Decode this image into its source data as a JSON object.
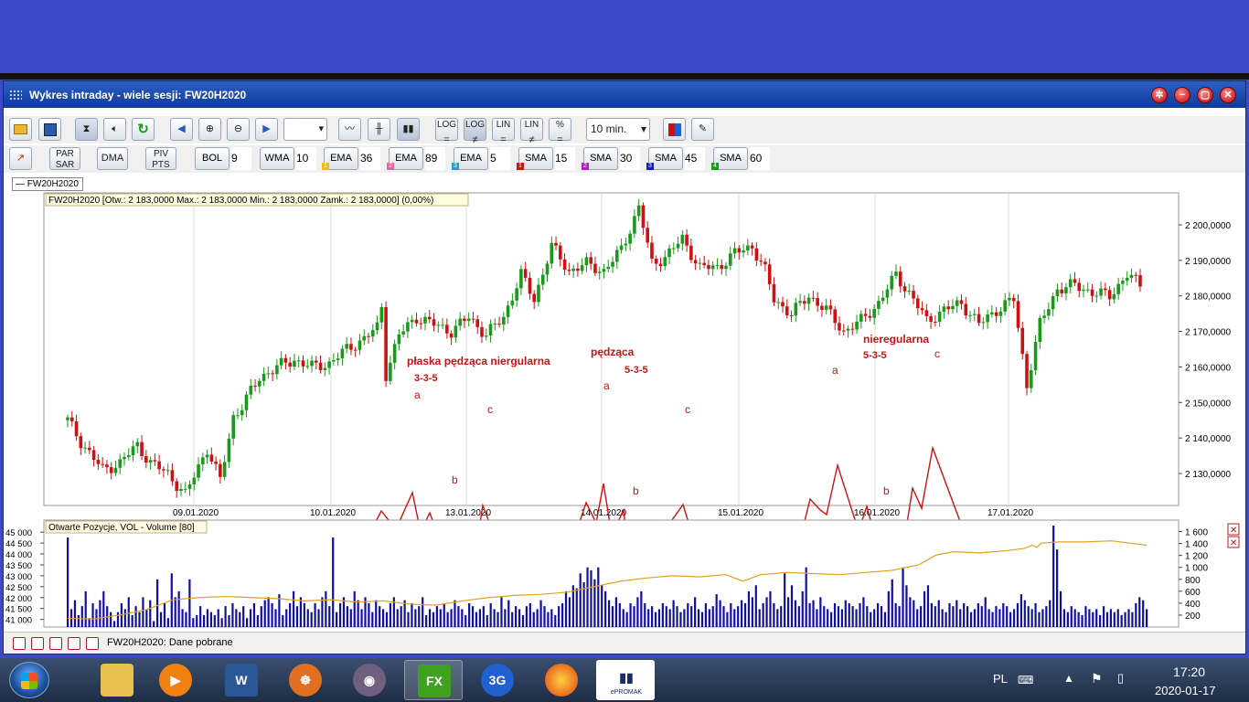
{
  "window": {
    "title": "Wykres intraday -  wiele sesji: FW20H2020"
  },
  "toolbar1": {
    "period_value": "",
    "interval_value": "10 min."
  },
  "toolbar1_labels": {
    "log1": "LOG",
    "log2": "LOG",
    "lin1": "LIN",
    "lin2": "LIN",
    "pct": "%"
  },
  "toolbar2": {
    "par_sar": [
      "PAR",
      "SAR"
    ],
    "dma": "DMA",
    "piv_pts": [
      "PIV",
      "PTS"
    ],
    "indicators": [
      {
        "label": "BOL",
        "value": "9"
      },
      {
        "label": "WMA",
        "value": "10"
      },
      {
        "label": "EMA",
        "value": "36",
        "marker": "1",
        "marker_color": "#f0c000"
      },
      {
        "label": "EMA",
        "value": "89",
        "marker": "2",
        "marker_color": "#f060a0"
      },
      {
        "label": "EMA",
        "value": "5",
        "marker": "3",
        "marker_color": "#20a0d0"
      },
      {
        "label": "SMA",
        "value": "15",
        "marker": "1",
        "marker_color": "#d01010"
      },
      {
        "label": "SMA",
        "value": "30",
        "marker": "2",
        "marker_color": "#b020c0"
      },
      {
        "label": "SMA",
        "value": "45",
        "marker": "3",
        "marker_color": "#1020c0"
      },
      {
        "label": "SMA",
        "value": "60",
        "marker": "4",
        "marker_color": "#10a010"
      }
    ]
  },
  "legend": {
    "symbol": "— FW20H2020"
  },
  "chart_data": [
    {
      "type": "candlestick",
      "info": "FW20H2020 [Otw.: 2 183,0000  Max.: 2 183,0000  Min.: 2 183,0000  Zamk.: 2 183,0000] (0,00%)",
      "yticks": [
        2200000,
        2190000,
        2180000,
        2170000,
        2160000,
        2150000,
        2140000,
        2130000
      ],
      "ytick_labels": [
        "2 200,0000",
        "2 190,0000",
        "2 180,0000",
        "2 170,0000",
        "2 160,0000",
        "2 150,0000",
        "2 140,0000",
        "2 130,0000"
      ],
      "ylim": [
        2121,
        2209
      ],
      "x_labels": [
        "09.01.2020",
        "10.01.2020",
        "13.01.2020",
        "14.01.2020",
        "15.01.2020",
        "16.01.2020",
        "17.01.2020"
      ],
      "price_path": [
        [
          0,
          2145
        ],
        [
          3,
          2139
        ],
        [
          8,
          2131
        ],
        [
          12,
          2133
        ],
        [
          16,
          2138
        ],
        [
          19,
          2133
        ],
        [
          23,
          2130
        ],
        [
          27,
          2124
        ],
        [
          30,
          2132
        ],
        [
          32,
          2137
        ],
        [
          35,
          2128
        ],
        [
          38,
          2146
        ],
        [
          40,
          2149
        ],
        [
          44,
          2157
        ],
        [
          48,
          2160
        ],
        [
          52,
          2162
        ],
        [
          56,
          2160
        ],
        [
          60,
          2161
        ],
        [
          64,
          2165
        ],
        [
          68,
          2168
        ],
        [
          71,
          2171
        ],
        [
          72,
          2177
        ],
        [
          73,
          2158
        ],
        [
          76,
          2169
        ],
        [
          80,
          2174
        ],
        [
          84,
          2172
        ],
        [
          88,
          2170
        ],
        [
          92,
          2174
        ],
        [
          96,
          2169
        ],
        [
          100,
          2174
        ],
        [
          104,
          2186
        ],
        [
          107,
          2179
        ],
        [
          111,
          2194
        ],
        [
          115,
          2187
        ],
        [
          119,
          2189
        ],
        [
          123,
          2187
        ],
        [
          127,
          2193
        ],
        [
          131,
          2205
        ],
        [
          134,
          2189
        ],
        [
          137,
          2191
        ],
        [
          141,
          2196
        ],
        [
          145,
          2188
        ],
        [
          149,
          2188
        ],
        [
          153,
          2192
        ],
        [
          157,
          2194
        ],
        [
          160,
          2187
        ],
        [
          162,
          2179
        ],
        [
          166,
          2175
        ],
        [
          170,
          2180
        ],
        [
          174,
          2176
        ],
        [
          178,
          2170
        ],
        [
          182,
          2173
        ],
        [
          186,
          2178
        ],
        [
          190,
          2186
        ],
        [
          194,
          2179
        ],
        [
          197,
          2173
        ],
        [
          201,
          2176
        ],
        [
          205,
          2178
        ],
        [
          209,
          2172
        ],
        [
          213,
          2176
        ],
        [
          217,
          2179
        ],
        [
          220,
          2155
        ],
        [
          223,
          2172
        ],
        [
          227,
          2182
        ],
        [
          231,
          2183
        ],
        [
          235,
          2181
        ],
        [
          239,
          2180
        ],
        [
          243,
          2186
        ],
        [
          246,
          2183
        ]
      ],
      "annotations": [
        {
          "text": "płaska pędząca niergularna",
          "kind": "title"
        },
        {
          "text": "3-3-5",
          "kind": "label"
        },
        {
          "text": "a",
          "kind": "wave"
        },
        {
          "text": "b",
          "kind": "wave"
        },
        {
          "text": "c",
          "kind": "wave"
        },
        {
          "text": "pędząca",
          "kind": "title"
        },
        {
          "text": "5-3-5",
          "kind": "label"
        },
        {
          "text": "a",
          "kind": "wave"
        },
        {
          "text": "b",
          "kind": "wave"
        },
        {
          "text": "c",
          "kind": "wave"
        },
        {
          "text": "nieregularna",
          "kind": "title"
        },
        {
          "text": "5-3-5",
          "kind": "label"
        },
        {
          "text": "a",
          "kind": "wave"
        },
        {
          "text": "b",
          "kind": "wave"
        },
        {
          "text": "c",
          "kind": "wave"
        }
      ]
    },
    {
      "type": "bar",
      "title": "Otwarte Pozycje, VOL - Volume [80]",
      "left_ticks": [
        "45 000",
        "44 500",
        "44 000",
        "43 500",
        "43 000",
        "42 500",
        "42 000",
        "41 500",
        "41 000"
      ],
      "right_ticks": [
        "1 600",
        "1 400",
        "1 200",
        "1 000",
        "800",
        "600",
        "400",
        "200"
      ],
      "right_ylim": [
        0,
        1700
      ],
      "left_ylim": [
        40650,
        45300
      ],
      "volume": [
        1500,
        300,
        450,
        200,
        350,
        600,
        150,
        400,
        300,
        450,
        600,
        350,
        250,
        100,
        250,
        400,
        300,
        500,
        200,
        350,
        250,
        500,
        300,
        450,
        100,
        800,
        250,
        400,
        150,
        900,
        500,
        600,
        300,
        250,
        800,
        150,
        200,
        350,
        200,
        300,
        250,
        200,
        300,
        150,
        350,
        200,
        400,
        300,
        250,
        350,
        150,
        300,
        400,
        200,
        350,
        450,
        500,
        400,
        300,
        550,
        200,
        300,
        400,
        600,
        350,
        500,
        400,
        300,
        250,
        400,
        300,
        500,
        600,
        350,
        1500,
        250,
        400,
        500,
        350,
        300,
        600,
        450,
        300,
        500,
        400,
        250,
        450,
        350,
        300,
        250,
        400,
        500,
        300,
        350,
        450,
        250,
        400,
        300,
        350,
        500,
        200,
        300,
        250,
        350,
        300,
        400,
        250,
        300,
        450,
        350,
        300,
        200,
        400,
        350,
        250,
        300,
        350,
        200,
        400,
        300,
        250,
        500,
        300,
        450,
        250,
        350,
        300,
        200,
        350,
        400,
        250,
        300,
        450,
        350,
        250,
        300,
        200,
        350,
        400,
        600,
        500,
        700,
        650,
        900,
        750,
        1000,
        950,
        800,
        1000,
        700,
        600,
        450,
        350,
        500,
        400,
        300,
        250,
        400,
        350,
        500,
        600,
        400,
        300,
        350,
        250,
        300,
        400,
        350,
        300,
        450,
        350,
        250,
        300,
        400,
        350,
        500,
        300,
        250,
        400,
        300,
        350,
        550,
        450,
        350,
        250,
        400,
        300,
        350,
        450,
        400,
        600,
        500,
        700,
        300,
        400,
        500,
        600,
        400,
        300,
        350,
        900,
        500,
        700,
        450,
        350,
        600,
        1000,
        400,
        450,
        300,
        500,
        350,
        300,
        250,
        400,
        350,
        300,
        450,
        400,
        350,
        300,
        400,
        500,
        350,
        250,
        300,
        400,
        350,
        250,
        600,
        800,
        400,
        350,
        1000,
        700,
        500,
        450,
        300,
        350,
        600,
        700,
        400,
        350,
        450,
        300,
        250,
        400,
        350,
        450,
        300,
        400,
        350,
        250,
        300,
        400,
        350,
        500,
        300,
        250,
        350,
        300,
        400,
        350,
        250,
        300,
        400,
        550,
        450,
        350,
        300,
        400,
        250,
        300,
        350,
        450,
        1700,
        1300,
        600,
        300,
        250,
        350,
        300,
        250,
        200,
        350,
        300,
        250,
        300,
        200,
        350,
        250,
        300,
        250,
        300,
        200,
        250,
        300,
        250,
        400,
        500,
        450,
        300
      ],
      "open_interest": [
        [
          0,
          41050
        ],
        [
          6,
          41020
        ],
        [
          12,
          41200
        ],
        [
          18,
          41450
        ],
        [
          24,
          41900
        ],
        [
          30,
          42000
        ],
        [
          36,
          42050
        ],
        [
          42,
          42000
        ],
        [
          48,
          41950
        ],
        [
          54,
          41850
        ],
        [
          60,
          41900
        ],
        [
          66,
          41800
        ],
        [
          72,
          41850
        ],
        [
          78,
          41700
        ],
        [
          84,
          41650
        ],
        [
          90,
          41850
        ],
        [
          96,
          42000
        ],
        [
          102,
          42100
        ],
        [
          108,
          42150
        ],
        [
          114,
          42250
        ],
        [
          120,
          42500
        ],
        [
          126,
          42750
        ],
        [
          132,
          42900
        ],
        [
          138,
          43000
        ],
        [
          144,
          42950
        ],
        [
          150,
          43050
        ],
        [
          154,
          42750
        ],
        [
          158,
          43050
        ],
        [
          164,
          43150
        ],
        [
          170,
          43100
        ],
        [
          176,
          43050
        ],
        [
          182,
          43150
        ],
        [
          188,
          43250
        ],
        [
          194,
          43500
        ],
        [
          198,
          43950
        ],
        [
          202,
          44100
        ],
        [
          208,
          44050
        ],
        [
          214,
          44150
        ],
        [
          218,
          44250
        ],
        [
          220,
          44400
        ],
        [
          221,
          44300
        ],
        [
          222,
          44500
        ],
        [
          226,
          44550
        ],
        [
          232,
          44550
        ],
        [
          238,
          44600
        ],
        [
          244,
          44450
        ],
        [
          246,
          44400
        ]
      ]
    }
  ],
  "status": {
    "text": "FW20H2020: Dane pobrane"
  },
  "taskbar": {
    "language": "PL",
    "time": "17:20",
    "date": "2020-01-17",
    "app_label": "ePROMAK"
  },
  "colors": {
    "up": "#1a9a1a",
    "down": "#d01010",
    "volume": "#1010a0",
    "oi": "#e0a020",
    "annotation": "#d01010",
    "window_title": "#0f3b9a"
  }
}
